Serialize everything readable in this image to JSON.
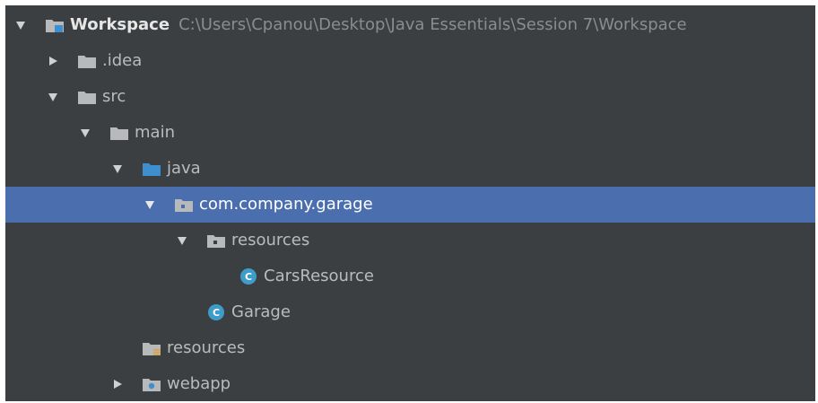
{
  "tree": {
    "root": {
      "label": "Workspace",
      "path": "C:\\Users\\Cpanou\\Desktop\\Java Essentials\\Session 7\\Workspace",
      "expanded": true,
      "icon": "module-folder-icon"
    },
    "idea": {
      "label": ".idea",
      "expanded": false,
      "icon": "folder-icon"
    },
    "src": {
      "label": "src",
      "expanded": true,
      "icon": "folder-icon"
    },
    "main": {
      "label": "main",
      "expanded": true,
      "icon": "folder-icon"
    },
    "java": {
      "label": "java",
      "expanded": true,
      "icon": "source-root-folder-icon"
    },
    "package": {
      "label": "com.company.garage",
      "expanded": true,
      "selected": true,
      "icon": "package-icon"
    },
    "resources_pkg": {
      "label": "resources",
      "expanded": true,
      "icon": "package-icon"
    },
    "cars_resource": {
      "label": "CarsResource",
      "icon": "java-class-icon"
    },
    "garage": {
      "label": "Garage",
      "icon": "java-class-icon"
    },
    "resources_root": {
      "label": "resources",
      "icon": "resources-root-folder-icon"
    },
    "webapp": {
      "label": "webapp",
      "expanded": false,
      "icon": "web-folder-icon"
    }
  },
  "colors": {
    "background": "#3c3f41",
    "selection": "#4b6eaf",
    "text": "#bbbbbb",
    "path_text": "#8c8c8c",
    "folder": "#b7b9bb",
    "source_folder": "#3d8fd0",
    "class_icon": "#3d9cc9"
  }
}
